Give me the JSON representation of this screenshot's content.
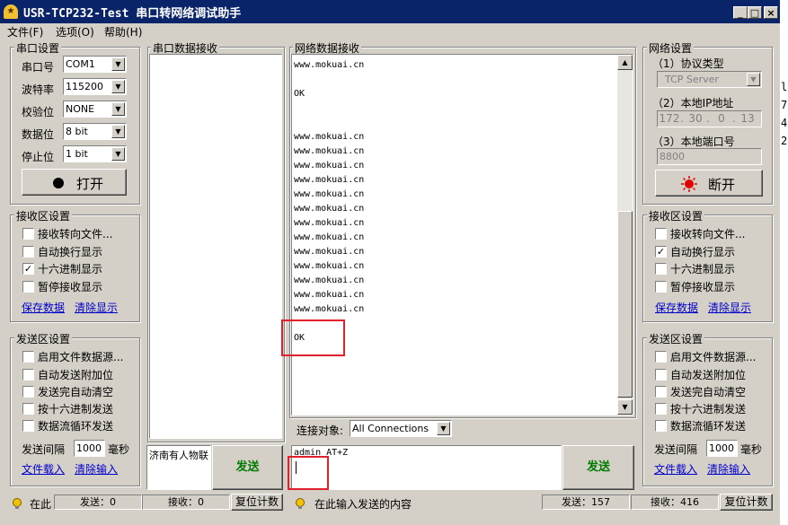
{
  "title": "USR-TCP232-Test 串口转网络调试助手",
  "app_icon": "★",
  "title_buttons": {
    "minimize": "_",
    "maximize": "□",
    "close": "×"
  },
  "menu": [
    "文件(F)",
    "选项(O)",
    "帮助(H)"
  ],
  "serial_settings": {
    "title": "串口设置",
    "port_label": "串口号",
    "port_value": "COM1",
    "baud_label": "波特率",
    "baud_value": "115200",
    "parity_label": "校验位",
    "parity_value": "NONE",
    "databits_label": "数据位",
    "databits_value": "8 bit",
    "stopbits_label": "停止位",
    "stopbits_value": "1 bit",
    "open_button": "打开"
  },
  "left_recv": {
    "title": "接收区设置",
    "options": [
      {
        "label": "接收转向文件...",
        "checked": false
      },
      {
        "label": "自动换行显示",
        "checked": false
      },
      {
        "label": "十六进制显示",
        "checked": true
      },
      {
        "label": "暂停接收显示",
        "checked": false
      }
    ],
    "save_link": "保存数据",
    "clear_link": "清除显示"
  },
  "left_send": {
    "title": "发送区设置",
    "options": [
      {
        "label": "启用文件数据源...",
        "checked": false
      },
      {
        "label": "自动发送附加位",
        "checked": false
      },
      {
        "label": "发送完自动清空",
        "checked": false
      },
      {
        "label": "按十六进制发送",
        "checked": false
      },
      {
        "label": "数据流循环发送",
        "checked": false
      }
    ],
    "interval_label": "发送间隔",
    "interval_value": "1000",
    "interval_unit": "毫秒",
    "load_link": "文件载入",
    "clear_link": "清除输入"
  },
  "serial_recv": {
    "title": "串口数据接收"
  },
  "serial_send": {
    "text": "济南有人物联",
    "send_button": "发送"
  },
  "net_recv": {
    "title": "网络数据接收",
    "lines": [
      "www.mokuai.cn",
      "",
      "OK",
      "",
      "",
      "www.mokuai.cn",
      "www.mokuai.cn",
      "www.mokuai.cn",
      "www.mokuai.cn",
      "www.mokuai.cn",
      "www.mokuai.cn",
      "www.mokuai.cn",
      "www.mokuai.cn",
      "www.mokuai.cn",
      "www.mokuai.cn",
      "www.mokuai.cn",
      "www.mokuai.cn",
      "www.mokuai.cn",
      "",
      "OK"
    ]
  },
  "connection": {
    "label": "连接对象:",
    "value": "All Connections"
  },
  "net_send": {
    "text": "admin AT+Z",
    "send_button": "发送"
  },
  "net_settings": {
    "title": "网络设置",
    "protocol_label": "（1）协议类型",
    "protocol_value": "TCP Server",
    "ip_label": "（2）本地IP地址",
    "ip_octets": [
      "172",
      "30",
      "0",
      "13"
    ],
    "port_label": "（3）本地端口号",
    "port_value": "8800",
    "disconnect_button": "断开"
  },
  "right_recv": {
    "title": "接收区设置",
    "options": [
      {
        "label": "接收转向文件...",
        "checked": false
      },
      {
        "label": "自动换行显示",
        "checked": true
      },
      {
        "label": "十六进制显示",
        "checked": false
      },
      {
        "label": "暂停接收显示",
        "checked": false
      }
    ],
    "save_link": "保存数据",
    "clear_link": "清除显示"
  },
  "right_send": {
    "title": "发送区设置",
    "options": [
      {
        "label": "启用文件数据源...",
        "checked": false
      },
      {
        "label": "自动发送附加位",
        "checked": false
      },
      {
        "label": "发送完自动清空",
        "checked": false
      },
      {
        "label": "按十六进制发送",
        "checked": false
      },
      {
        "label": "数据流循环发送",
        "checked": false
      }
    ],
    "interval_label": "发送间隔",
    "interval_value": "1000",
    "interval_unit": "毫秒",
    "load_link": "文件载入",
    "clear_link": "清除输入"
  },
  "status_left": {
    "hint": "在此",
    "send": "发送：0",
    "recv": "接收：0",
    "reset": "复位计数"
  },
  "status_right": {
    "hint": "在此输入发送的内容",
    "send": "发送：157",
    "recv": "接收：416",
    "reset": "复位计数"
  },
  "side_glyphs": [
    "l",
    "7",
    "4",
    "2"
  ],
  "colors": {
    "title_bg": "#0a246a",
    "annotation": "#e0202a",
    "send_text": "#007a00",
    "link": "#0000cc"
  }
}
